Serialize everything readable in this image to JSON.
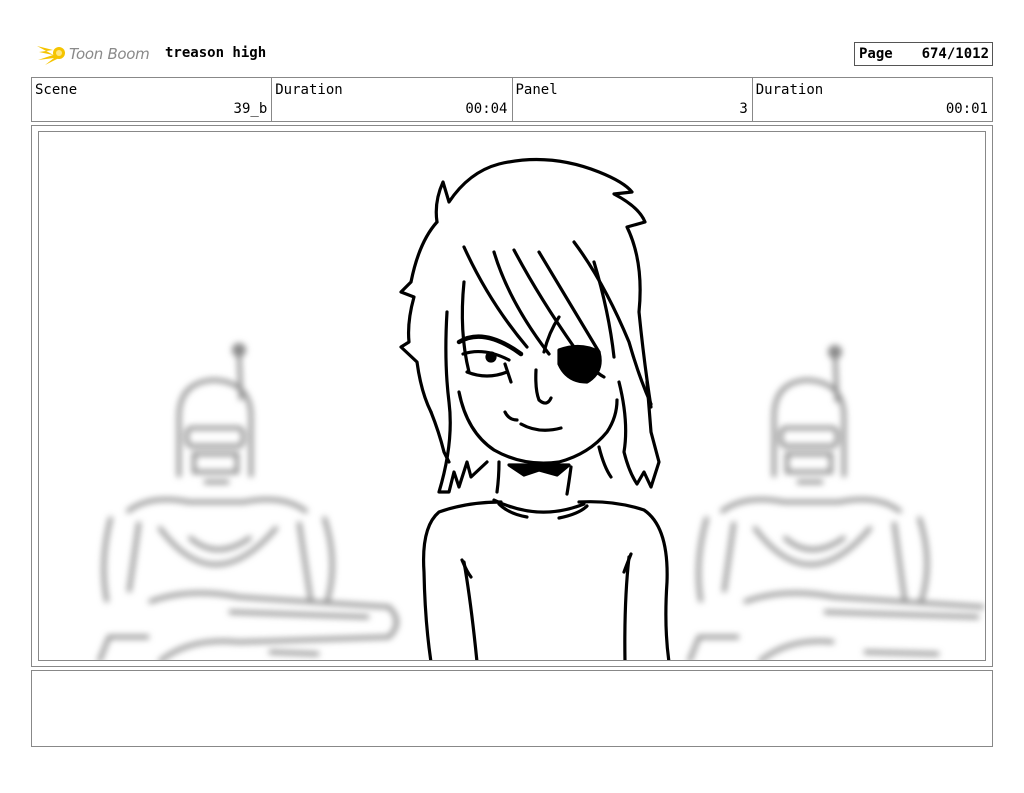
{
  "header": {
    "logo_text": "Toon Boom",
    "project_title": "treason high",
    "page_label": "Page",
    "page_value": "674/1012"
  },
  "info": {
    "scene_label": "Scene",
    "scene_value": "39_b",
    "scene_duration_label": "Duration",
    "scene_duration_value": "00:04",
    "panel_label": "Panel",
    "panel_value": "3",
    "panel_duration_label": "Duration",
    "panel_duration_value": "00:01"
  },
  "panel": {
    "foreground": "character-sketch",
    "background": "two-blurred-robot-guards"
  },
  "notes": {
    "text": ""
  },
  "colors": {
    "logo_accent": "#f5c400",
    "border": "#888888"
  }
}
